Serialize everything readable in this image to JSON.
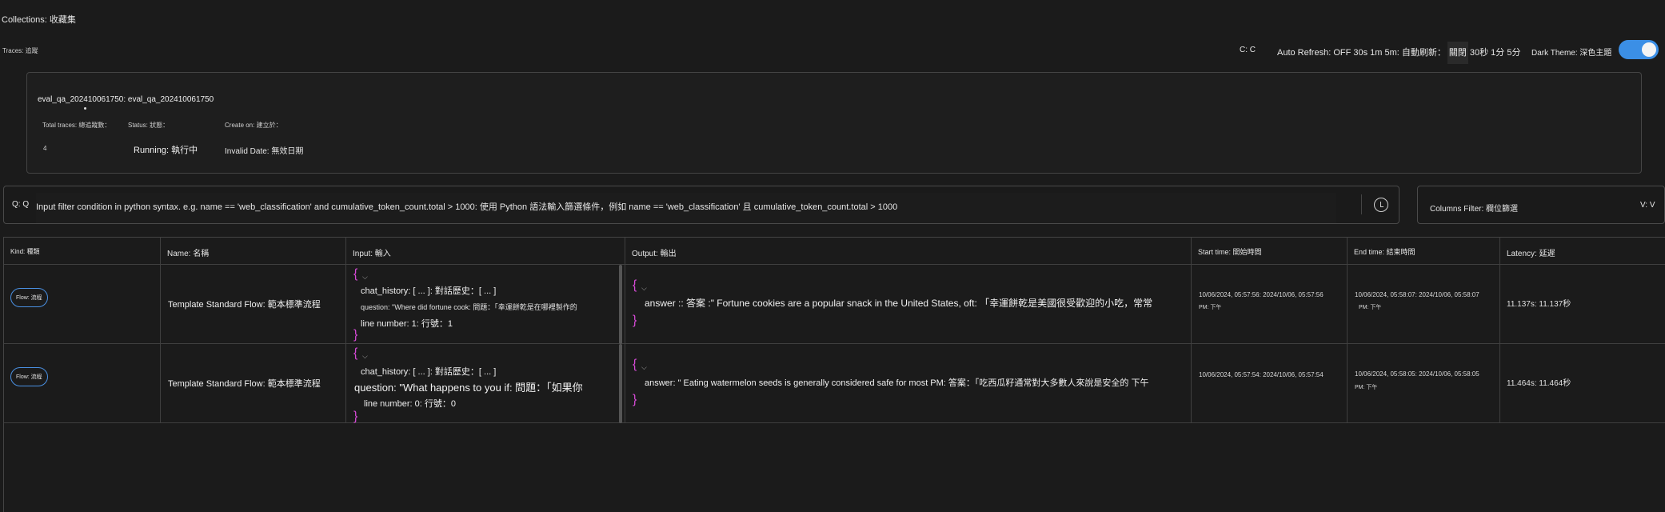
{
  "header": {
    "collections": "Collections: 收藏集",
    "traces": "Traces: 追蹤",
    "cc": "C: C",
    "auto_refresh_label": "Auto Refresh: OFF 30s 1m 5m: 自動刷新：",
    "auto_refresh_off": "關閉",
    "auto_refresh_rest": "30秒 1分 5分",
    "dark_theme": "Dark Theme: 深色主題",
    "dark_theme_on": true
  },
  "run": {
    "name": "eval_qa_202410061750: eval_qa_202410061750",
    "total_traces_label": "Total traces: 總追蹤數：",
    "status_label": "Status: 狀態：",
    "create_on_label": "Create on: 建立於：",
    "total_traces_value": "4",
    "status_value": "Running: 執行中",
    "create_on_value": "Invalid Date: 無效日期"
  },
  "filter": {
    "prefix": "Q: Q",
    "placeholder": "Input filter condition in python syntax. e.g. name == 'web_classification' and cumulative_token_count.total > 1000: 使用 Python 語法輸入篩選條件，例如 name == 'web_classification' 且 cumulative_token_count.total > 1000",
    "columns_filter": "Columns Filter: 欄位篩選",
    "columns_filter_v": "V: V"
  },
  "table": {
    "headers": [
      "Kind: 種類",
      "Name: 名稱",
      "Input: 輸入",
      "Output: 輸出",
      "Start time: 開始時間",
      "End time: 結束時間",
      "Latency: 延遲"
    ],
    "rows": [
      {
        "kind": "Flow: 流程",
        "name": "Template Standard Flow: 範本標準流程",
        "input_chat_history": "chat_history: [ ... ]: 對話歷史：[ ... ]",
        "input_question": "question: \"Where did fortune cook: 問題：「幸運餅乾是在哪裡製作的",
        "input_line": "line number: 1: 行號：1",
        "output": "answer :: 答案 :\" Fortune cookies are a popular snack in the United States, oft: 「幸運餅乾是美國很受歡迎的小吃，常常",
        "start": "10/06/2024, 05:57:56: 2024/10/06, 05:57:56",
        "start2": "PM: 下午",
        "end": "10/06/2024, 05:58:07: 2024/10/06, 05:58:07",
        "end2": "PM: 下午",
        "latency": "11.137s: 11.137秒"
      },
      {
        "kind": "Flow: 流程",
        "name": "Template Standard Flow: 範本標準流程",
        "input_chat_history": "chat_history: [ ... ]: 對話歷史：[ ... ]",
        "input_question": "question: \"What happens to you if: 問題：「如果你",
        "input_line": "line number: 0: 行號：0",
        "output": "answer: \" Eating watermelon seeds is generally considered safe for most PM: 答案：「吃西瓜籽通常對大多數人來說是安全的 下午",
        "start": "10/06/2024, 05:57:54: 2024/10/06, 05:57:54",
        "start2": "",
        "end": "10/06/2024, 05:58:05: 2024/10/06, 05:58:05",
        "end2": "PM: 下午",
        "latency": "11.464s: 11.464秒"
      }
    ]
  }
}
